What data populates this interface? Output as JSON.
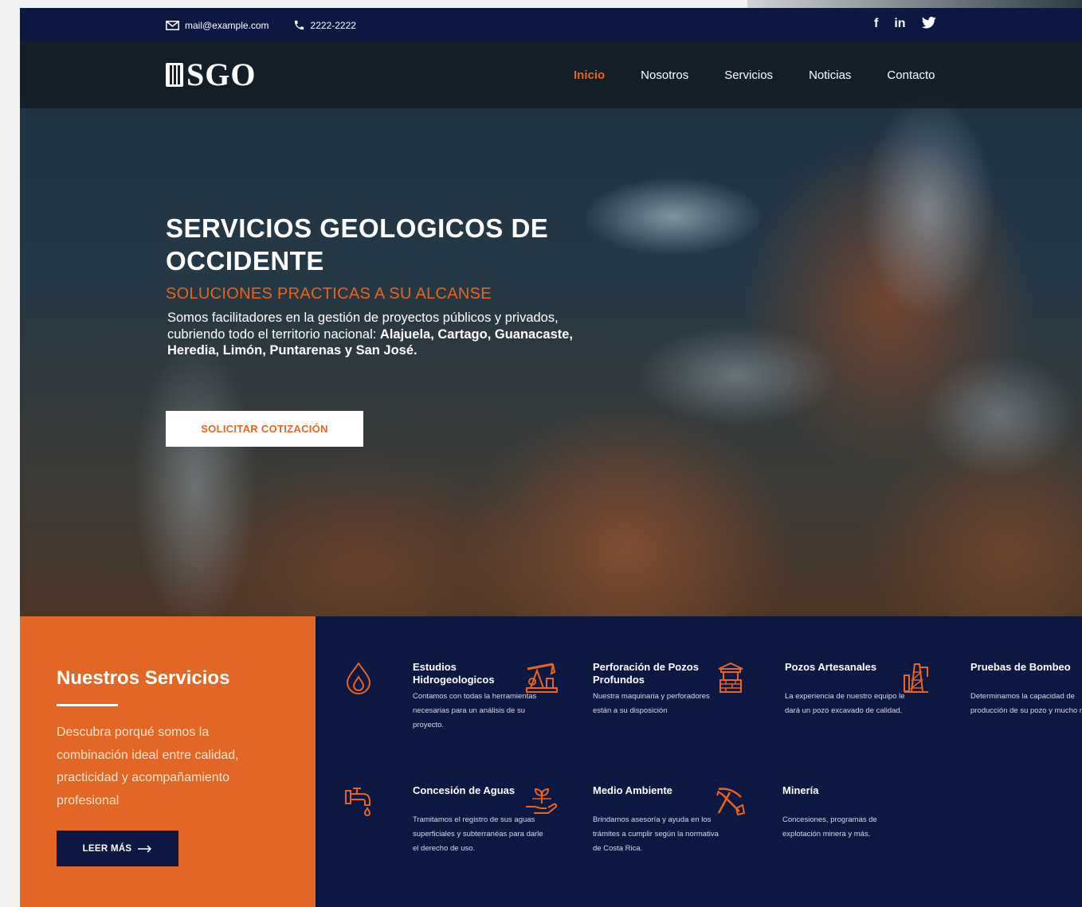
{
  "topbar": {
    "email": "mail@example.com",
    "phone": "2222-2222",
    "social": [
      "f",
      "in",
      "🐦"
    ]
  },
  "brand": {
    "name": "SGO"
  },
  "nav": [
    {
      "label": "Inicio",
      "active": true
    },
    {
      "label": "Nosotros",
      "active": false
    },
    {
      "label": "Servicios",
      "active": false
    },
    {
      "label": "Noticias",
      "active": false
    },
    {
      "label": "Contacto",
      "active": false
    }
  ],
  "hero": {
    "title": "SERVICIOS GEOLOGICOS DE OCCIDENTE",
    "subtitle": "SOLUCIONES PRACTICAS A SU ALCANSE",
    "desc_intro": "Somos facilitadores en la gestión de proyectos públicos y privados, cubriendo todo el territorio nacional: ",
    "desc_bold": "Alajuela, Cartago, Guanacaste, Heredia, Limón, Puntarenas y San José.",
    "cta": "SOLICITAR COTIZACIÓN"
  },
  "services": {
    "heading": "Nuestros Servicios",
    "text": "Descubra porqué somos la combinación ideal entre calidad, practicidad y acompañamiento profesional",
    "button": "LEER MÁS",
    "items": [
      {
        "icon": "water-drop-icon",
        "title": "Estudios Hidrogeologicos",
        "desc": "Contamos con todas la herramientas necesarias para un análisis de su proyecto."
      },
      {
        "icon": "pump-jack-icon",
        "title": "Perforación de Pozos Profundos",
        "desc": "Nuestra maquinaria y perforadores están a su disposición"
      },
      {
        "icon": "well-icon",
        "title": "Pozos Artesanales",
        "desc": "La experiencia de nuestro equipo le dará un pozo excavado de calidad."
      },
      {
        "icon": "oil-rig-icon",
        "title": "Pruebas de Bombeo",
        "desc": "Determinamos la capacidad de producción de su pozo y mucho más."
      },
      {
        "icon": "faucet-icon",
        "title": "Concesión de Aguas",
        "desc": "Tramitamos el registro de sus aguas superficiales y subterranéas para darle el derecho de uso."
      },
      {
        "icon": "plant-hand-icon",
        "title": "Medio Ambiente",
        "desc": "Brindamos asesoría y ayuda en los trámites a cumplir según la normativa de Costa Rica."
      },
      {
        "icon": "pickaxe-shovel-icon",
        "title": "Minería",
        "desc": "Concesiones, programas de explotación minera y más."
      }
    ]
  },
  "colors": {
    "navy": "#0c1742",
    "orange": "#e26624",
    "accent": "#e8641f"
  }
}
